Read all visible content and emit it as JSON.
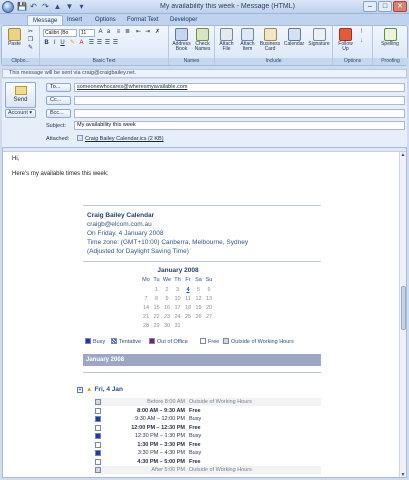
{
  "window": {
    "title": "My availability this week - Message (HTML)"
  },
  "qat": {
    "icons": [
      "save-icon",
      "undo-icon",
      "redo-icon",
      "up-icon",
      "down-icon",
      "customize-icon"
    ]
  },
  "ribbon": {
    "tabs": [
      "Message",
      "Insert",
      "Options",
      "Format Text",
      "Developer"
    ],
    "active_tab": "Message",
    "clipboard": {
      "paste": "Paste",
      "label": "Clipbo..."
    },
    "basic_text": {
      "font": "Calibri (Bo",
      "size": "11",
      "label": "Basic Text"
    },
    "names": {
      "address_book": [
        "Address",
        "Book"
      ],
      "check_names": [
        "Check",
        "Names"
      ],
      "label": "Names"
    },
    "include": {
      "attach_file": [
        "Attach",
        "File"
      ],
      "attach_item": [
        "Attach",
        "Item"
      ],
      "business_card": [
        "Business",
        "Card"
      ],
      "calendar": "Calendar",
      "signature": "Signature",
      "label": "Include"
    },
    "options": {
      "follow_up": [
        "Follow",
        "Up"
      ],
      "label": "Options"
    },
    "proofing": {
      "spelling": "Spelling",
      "label": "Proofing"
    }
  },
  "infobar": "This message will be sent via craig@craigbailey.net.",
  "header": {
    "send": "Send",
    "account": "Account",
    "to_label": "To...",
    "cc_label": "Cc...",
    "bcc_label": "Bcc...",
    "to_value": "someonewhocares@wheresmyavailable.com",
    "cc_value": "",
    "bcc_value": "",
    "subject_label": "Subject:",
    "subject_value": "My availability this week",
    "attached_label": "Attached:",
    "attachment": "Craig Bailey Calendar.ics (2 KB)"
  },
  "body": {
    "greeting": "Hi,",
    "line": "Here's my available times this week:",
    "card": {
      "name": "Craig Bailey Calendar",
      "email": "craigb@elcom.com.au",
      "date": "On Friday, 4 January 2008",
      "timezone": "Time zone: (GMT+10:00) Canberra, Melbourne, Sydney",
      "dst": "(Adjusted for Daylight Saving Time)"
    },
    "mini_calendar": {
      "title": "January 2008",
      "weekdays": [
        "Mo",
        "Tu",
        "We",
        "Th",
        "Fr",
        "Sa",
        "Su"
      ],
      "weeks": [
        [
          "",
          "1",
          "2",
          "3",
          "4",
          "5",
          "6"
        ],
        [
          "7",
          "8",
          "9",
          "10",
          "11",
          "12",
          "13"
        ],
        [
          "14",
          "15",
          "16",
          "17",
          "18",
          "19",
          "20"
        ],
        [
          "21",
          "22",
          "23",
          "24",
          "25",
          "26",
          "27"
        ],
        [
          "28",
          "29",
          "30",
          "31",
          "",
          "",
          ""
        ]
      ],
      "highlighted": "4"
    },
    "legend": [
      {
        "label": "Busy",
        "color": "#1f35b8"
      },
      {
        "label": "Tentative",
        "color": "#7d8fd6"
      },
      {
        "label": "Out of Office",
        "color": "#7b1d78"
      },
      {
        "label": "Free",
        "color": "#ffffff"
      },
      {
        "label": "Outside of Working Hours",
        "color": "#d6d8dc"
      }
    ],
    "month_header": "January 2008",
    "day_header": "Fri, 4 Jan",
    "slots": [
      {
        "time": "Before 8:00 AM",
        "status": "Outside of Working Hours",
        "kind": "out"
      },
      {
        "time": "8:00 AM – 9:30 AM",
        "status": "Free",
        "kind": "free"
      },
      {
        "time": "9:30 AM – 12:00 PM",
        "status": "Busy",
        "kind": "busy"
      },
      {
        "time": "12:00 PM – 12:30 PM",
        "status": "Free",
        "kind": "free"
      },
      {
        "time": "12:30 PM – 1:30 PM",
        "status": "Busy",
        "kind": "busy"
      },
      {
        "time": "1:30 PM – 3:30 PM",
        "status": "Free",
        "kind": "free"
      },
      {
        "time": "3:30 PM – 4:30 PM",
        "status": "Busy",
        "kind": "busy"
      },
      {
        "time": "4:30 PM – 5:00 PM",
        "status": "Free",
        "kind": "free"
      },
      {
        "time": "After 5:00 PM",
        "status": "Outside of Working Hours",
        "kind": "out"
      }
    ]
  }
}
